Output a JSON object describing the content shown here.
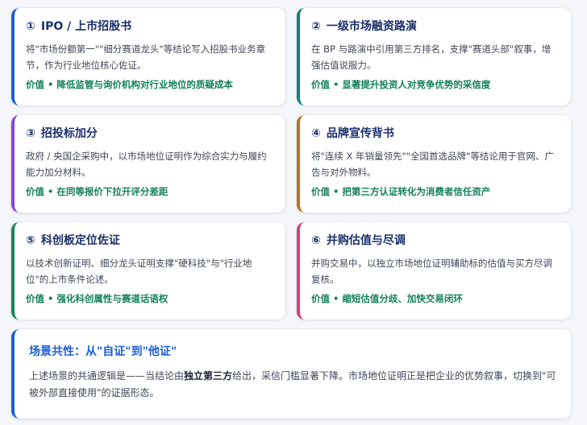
{
  "cards": [
    {
      "number": "①",
      "title": "IPO / 上市招股书",
      "description": "将\"市场份额第一\"\"细分赛道龙头\"等结论写入招股书业务章节，作为行业地位核心佐证。",
      "value": "价值 • 降低监管与询价机构对行业地位的质疑成本",
      "accent_color": "#1f5fd6"
    },
    {
      "number": "②",
      "title": "一级市场融资路演",
      "description": "在 BP 与路演中引用第三方排名，支撑\"赛道头部\"叙事，增强估值说服力。",
      "value": "价值 • 显著提升投资人对竞争优势的采信度",
      "accent_color": "#13807a"
    },
    {
      "number": "③",
      "title": "招投标加分",
      "description": "政府 / 央国企采购中，以市场地位证明作为综合实力与履约能力加分材料。",
      "value": "价值 • 在同等报价下拉开评分差距",
      "accent_color": "#8a44d8"
    },
    {
      "number": "④",
      "title": "品牌宣传背书",
      "description": "将\"连续 X 年销量领先\"\"全国首选品牌\"等结论用于官网、广告与对外物料。",
      "value": "价值 • 把第三方认证转化为消费者信任资产",
      "accent_color": "#b8741a"
    },
    {
      "number": "⑤",
      "title": "科创板定位佐证",
      "description": "以技术创新证明、细分龙头证明支撑\"硬科技\"与\"行业地位\"的上市条件论述。",
      "value": "价值 • 强化科创属性与赛道话语权",
      "accent_color": "#14855b"
    },
    {
      "number": "⑥",
      "title": "并购估值与尽调",
      "description": "并购交易中，以独立市场地位证明辅助标的估值与买方尽调复核。",
      "value": "价值 • 缩短估值分歧、加快交易闭环",
      "accent_color": "#d63d7a"
    }
  ],
  "summary": {
    "title": "场景共性：从\"自证\"到\"他证\"",
    "text_before": "上述场景的共通逻辑是——当结论由",
    "text_bold": "独立第三方",
    "text_after": "给出，采信门槛显著下降。市场地位证明正是把企业的优势叙事，切换到\"可被外部直接使用\"的证据形态。"
  }
}
